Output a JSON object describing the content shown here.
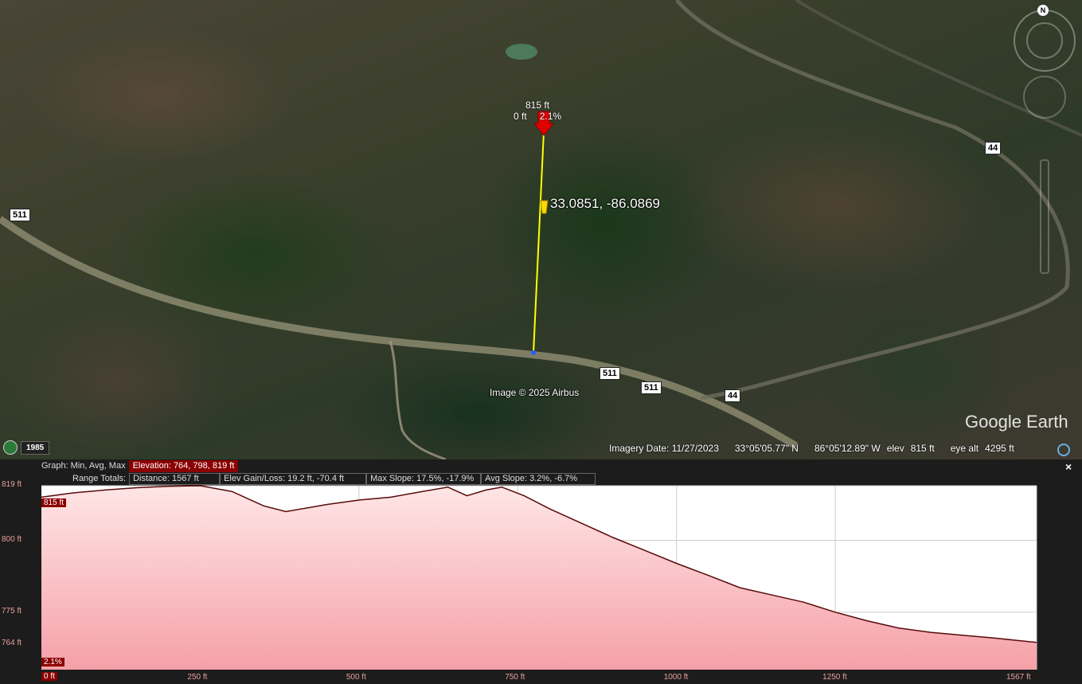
{
  "map": {
    "pin_top_elev": "815 ft",
    "pin_left": "0 ft",
    "pin_right": "2.1%",
    "coord_label": "33.0851, -86.0869",
    "copyright": "Image © 2025 Airbus",
    "route_labels": [
      "511",
      "511",
      "511",
      "44",
      "44"
    ],
    "history_year": "1985",
    "compass_n": "N",
    "logo": "Google Earth"
  },
  "status": {
    "imagery_date": "Imagery Date: 11/27/2023",
    "lat": "33°05'05.77\" N",
    "lon": "86°05'12.89\" W",
    "elev_label": "elev",
    "elev_value": "815 ft",
    "eye_label": "eye alt",
    "eye_value": "4295 ft"
  },
  "profile": {
    "graph_label": "Graph: Min, Avg, Max",
    "elevation_box": "Elevation: 764, 798, 819 ft",
    "range_label": "Range Totals:",
    "distance_box": "Distance: 1567 ft",
    "gain_box": "Elev Gain/Loss: 19.2 ft, -70.4 ft",
    "max_slope_box": "Max Slope: 17.5%, -17.9%",
    "avg_slope_box": "Avg Slope: 3.2%, -6.7%",
    "close": "×",
    "cursor_elev": "815 ft",
    "cursor_slope": "2.1%",
    "cursor_dist": "0 ft"
  },
  "chart_data": {
    "type": "area",
    "xlabel": "",
    "ylabel": "",
    "xlim": [
      0,
      1567
    ],
    "ylim": [
      755,
      819
    ],
    "x_ticks": [
      0,
      250,
      500,
      750,
      1000,
      1250,
      1567
    ],
    "x_tick_labels": [
      "0 ft",
      "250 ft",
      "500 ft",
      "750 ft",
      "1000 ft",
      "1250 ft",
      "1567 ft"
    ],
    "y_ticks": [
      819,
      800,
      775,
      764
    ],
    "y_tick_labels": [
      "819 ft",
      "800 ft",
      "775 ft",
      "764 ft"
    ],
    "series": [
      {
        "x": [
          0,
          50,
          100,
          150,
          200,
          250,
          300,
          350,
          385,
          450,
          500,
          550,
          600,
          640,
          670,
          700,
          725,
          760,
          800,
          850,
          900,
          950,
          1000,
          1050,
          1100,
          1150,
          1200,
          1250,
          1300,
          1350,
          1400,
          1450,
          1500,
          1567
        ],
        "values": [
          815,
          816.5,
          817.5,
          818.3,
          818.8,
          819,
          817,
          812,
          810,
          812.5,
          814,
          815,
          817,
          818.5,
          815.5,
          817.5,
          818.5,
          815.5,
          811,
          806,
          801,
          796.5,
          792,
          787.8,
          783.5,
          781,
          778.5,
          775,
          772,
          769.5,
          768,
          767,
          766,
          764.5
        ]
      }
    ],
    "colors": {
      "line": "#5a0a0a",
      "fill_top": "#ffe6e6",
      "fill_bottom": "#f5a0a8",
      "grid": "#cccccc"
    }
  }
}
